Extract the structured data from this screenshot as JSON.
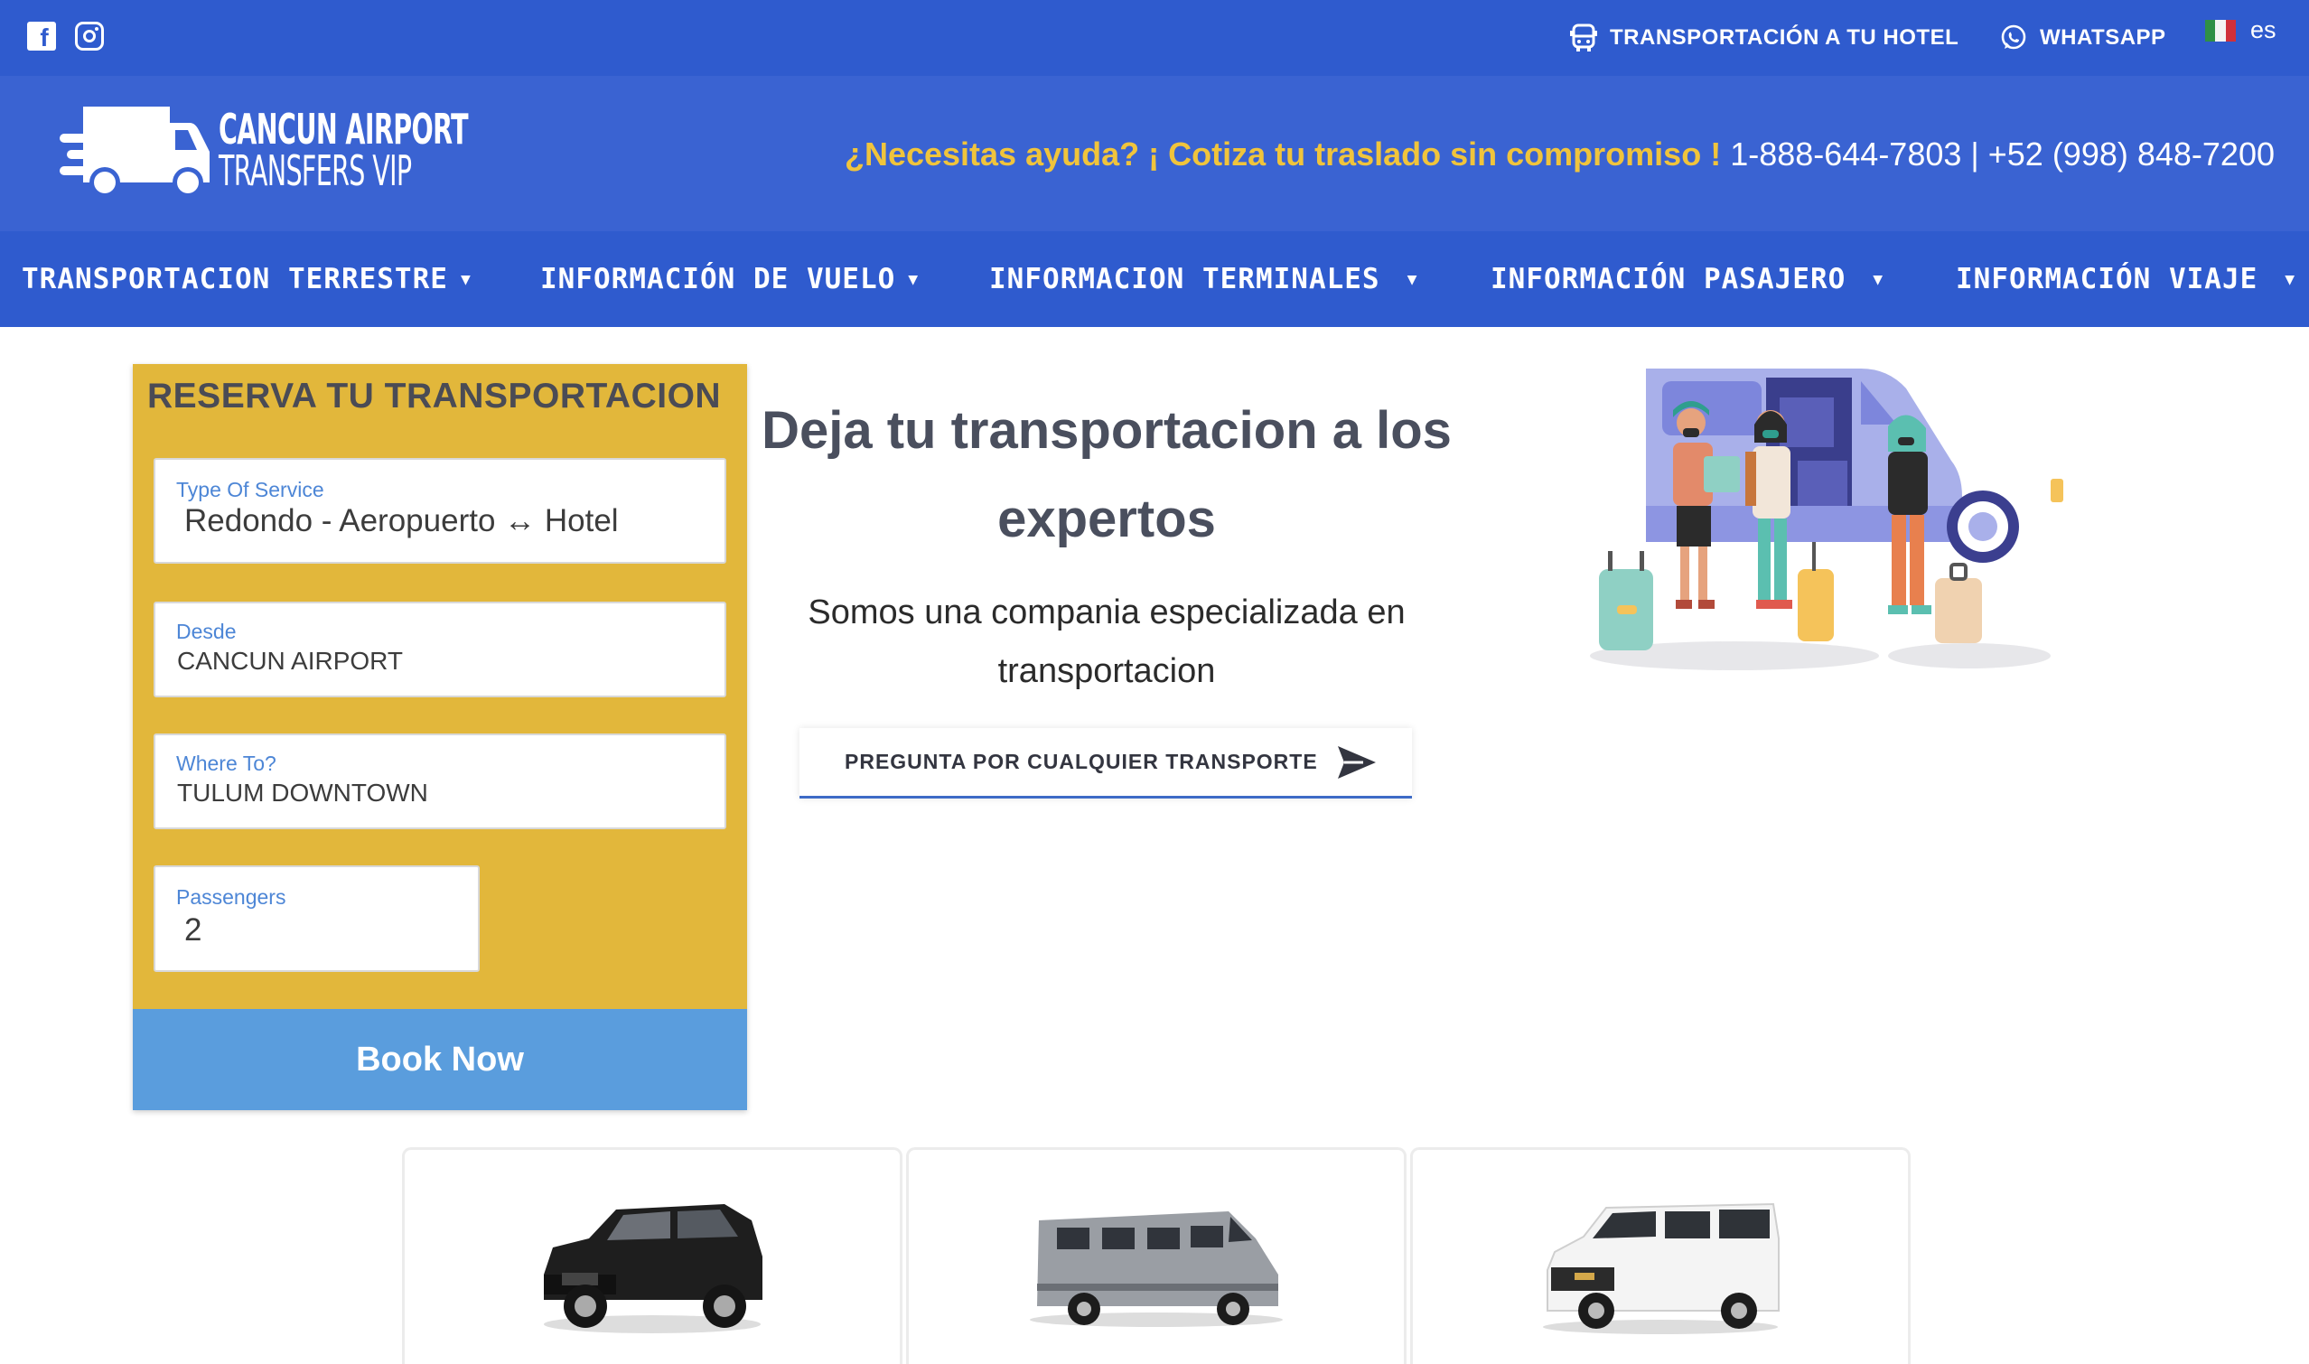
{
  "colors": {
    "topbar": "#2f5bce",
    "header": "#3a63d2",
    "booking_bg": "#e2b73b",
    "book_button": "#5a9ddd",
    "help_highlight": "#f0c43c"
  },
  "topbar": {
    "social": [
      "facebook-icon",
      "instagram-icon"
    ],
    "hotel_link": "TRANSPORTACIÓN A TU HOTEL",
    "whatsapp_link": "WHATSAPP",
    "lang": "es"
  },
  "header": {
    "logo_line1": "CANCUN AIRPORT",
    "logo_line2": "TRANSFERS VIP",
    "help_question": "¿Necesitas ayuda? ¡ Cotiza tu traslado sin compromiso !",
    "help_phones": " 1-888-644-7803 | +52 (998) 848-7200"
  },
  "nav": {
    "items": [
      {
        "label": "TRANSPORTACION TERRESTRE"
      },
      {
        "label": "INFORMACIÓN DE VUELO"
      },
      {
        "label": "INFORMACION TERMINALES"
      },
      {
        "label": "INFORMACIÓN PASAJERO"
      },
      {
        "label": "INFORMACIÓN VIAJE"
      }
    ]
  },
  "booking": {
    "title": "RESERVA TU TRANSPORTACION",
    "service_label": "Type Of Service",
    "service_value": "Redondo - Aeropuerto ↔ Hotel",
    "from_label": "Desde",
    "from_value": "CANCUN AIRPORT",
    "to_label": "Where To?",
    "to_value": "TULUM DOWNTOWN",
    "passengers_label": "Passengers",
    "passengers_value": "2",
    "book_button": "Book Now"
  },
  "hero": {
    "title": "Deja tu transportacion a los expertos",
    "subtitle": "Somos una compania especializada en transportacion",
    "cta_label": "PREGUNTA POR CUALQUIER TRANSPORTE"
  },
  "vehicles": [
    "suv-image",
    "sprinter-van-image",
    "passenger-van-image"
  ]
}
